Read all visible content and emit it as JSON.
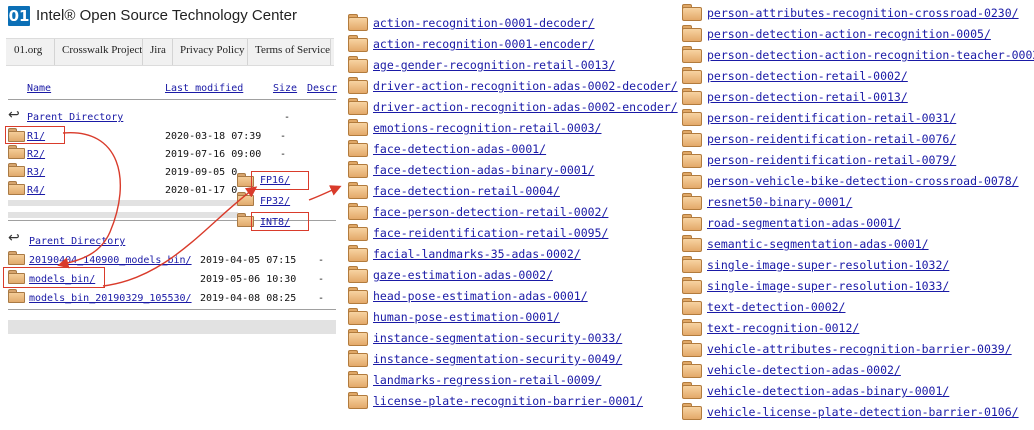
{
  "header": {
    "logo_text": "01",
    "site_title": "Intel® Open Source Technology Center"
  },
  "nav": {
    "items": [
      "01.org",
      "Crosswalk Project",
      "Jira",
      "Privacy Policy",
      "Terms of Service",
      "T"
    ]
  },
  "listing1": {
    "columns": {
      "name": "Name",
      "last_modified": "Last modified",
      "size": "Size",
      "description": "Descr"
    },
    "parent": "Parent Directory",
    "parent_size": "-",
    "rows": [
      {
        "name": "R1/",
        "date": "2020-03-18 07:39",
        "size": "-"
      },
      {
        "name": "R2/",
        "date": "2019-07-16 09:00",
        "size": "-"
      },
      {
        "name": "R3/",
        "date": "2019-09-05 0",
        "size": ""
      },
      {
        "name": "R4/",
        "date": "2020-01-17 0",
        "size": ""
      }
    ]
  },
  "precision_list": [
    "FP16/",
    "FP32/",
    "INT8/"
  ],
  "listing2": {
    "parent": "Parent Directory",
    "rows": [
      {
        "name": "20190404_140900_models_bin/",
        "date": "2019-04-05 07:15",
        "size": "-"
      },
      {
        "name": "models_bin/",
        "date": "2019-05-06 10:30",
        "size": "-"
      },
      {
        "name": "models_bin_20190329_105530/",
        "date": "2019-04-08 08:25",
        "size": "-"
      }
    ]
  },
  "models_column_1": [
    "action-recognition-0001-decoder/",
    "action-recognition-0001-encoder/",
    "age-gender-recognition-retail-0013/",
    "driver-action-recognition-adas-0002-decoder/",
    "driver-action-recognition-adas-0002-encoder/",
    "emotions-recognition-retail-0003/",
    "face-detection-adas-0001/",
    "face-detection-adas-binary-0001/",
    "face-detection-retail-0004/",
    "face-person-detection-retail-0002/",
    "face-reidentification-retail-0095/",
    "facial-landmarks-35-adas-0002/",
    "gaze-estimation-adas-0002/",
    "head-pose-estimation-adas-0001/",
    "human-pose-estimation-0001/",
    "instance-segmentation-security-0033/",
    "instance-segmentation-security-0049/",
    "landmarks-regression-retail-0009/",
    "license-plate-recognition-barrier-0001/"
  ],
  "models_column_2": [
    "person-attributes-recognition-crossroad-0230/",
    "person-detection-action-recognition-0005/",
    "person-detection-action-recognition-teacher-0002/",
    "person-detection-retail-0002/",
    "person-detection-retail-0013/",
    "person-reidentification-retail-0031/",
    "person-reidentification-retail-0076/",
    "person-reidentification-retail-0079/",
    "person-vehicle-bike-detection-crossroad-0078/",
    "resnet50-binary-0001/",
    "road-segmentation-adas-0001/",
    "semantic-segmentation-adas-0001/",
    "single-image-super-resolution-1032/",
    "single-image-super-resolution-1033/",
    "text-detection-0002/",
    "text-recognition-0012/",
    "vehicle-attributes-recognition-barrier-0039/",
    "vehicle-detection-adas-0002/",
    "vehicle-detection-adas-binary-0001/",
    "vehicle-license-plate-detection-barrier-0106/"
  ],
  "colors": {
    "link": "#1a1aa6",
    "annotation": "#d93b2b",
    "folder": "#e3a96a",
    "logo": "#0b6fb6"
  }
}
